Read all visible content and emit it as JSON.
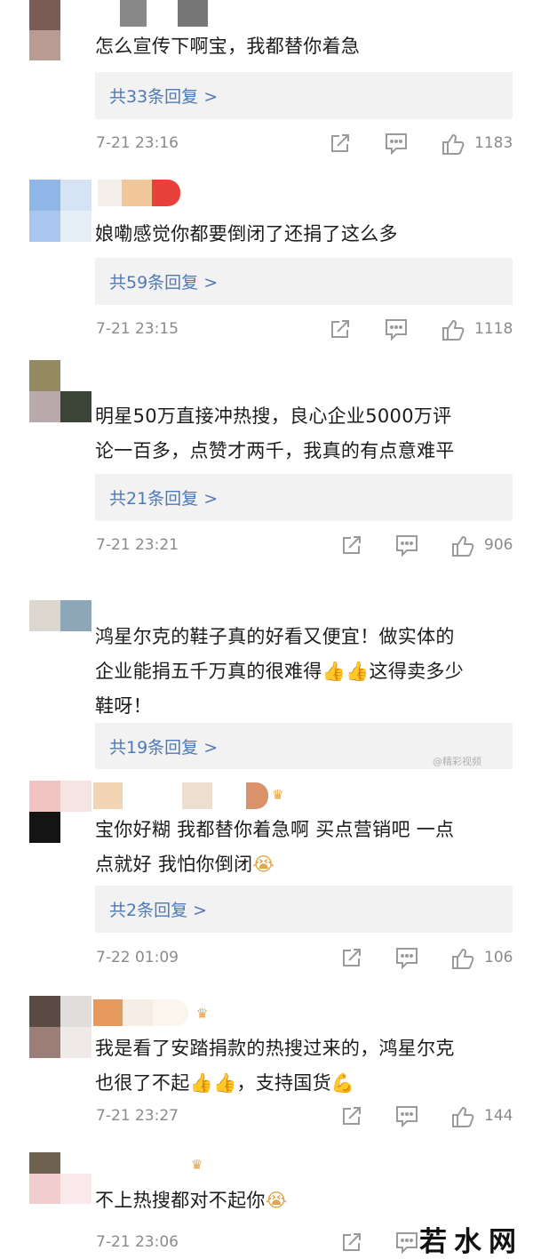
{
  "comments": [
    {
      "text": [
        "怎么宣传下啊宝，我都替你着急"
      ],
      "replies": "共33条回复",
      "chevron": ">",
      "time": "7-21 23:16",
      "likes": "1183"
    },
    {
      "text": [
        "娘嘞感觉你都要倒闭了还捐了这么多"
      ],
      "replies": "共59条回复",
      "chevron": ">",
      "time": "7-21 23:15",
      "likes": "1118"
    },
    {
      "text": [
        "明星50万直接冲热搜，良心企业5000万评",
        "论一百多，点赞才两千，我真的有点意难平"
      ],
      "replies": "共21条回复",
      "chevron": ">",
      "time": "7-21 23:21",
      "likes": "906"
    },
    {
      "text_lines": {
        "l1": "鸿星尔克的鞋子真的好看又便宜！做实体的",
        "l2a": "企业能捐五千万真的很难得",
        "l2emoji": "👍👍",
        "l2b": "这得卖多少",
        "l3": "鞋呀！"
      },
      "replies": "共19条回复",
      "chevron": ">"
    },
    {
      "text_lines": {
        "l1": "宝你好糊 我都替你着急啊 买点营销吧 一点",
        "l2": "点就好 我怕你倒闭",
        "l2emoji": "😭"
      },
      "replies": "共2条回复",
      "chevron": ">",
      "time": "7-22 01:09",
      "likes": "106"
    },
    {
      "text_lines": {
        "l1": "我是看了安踏捐款的热搜过来的，鸿星尔克",
        "l2a": "也很了不起",
        "l2emoji": "👍👍",
        "l2b": "，支持国货",
        "l2emoji2": "💪"
      },
      "time": "7-21 23:27",
      "likes": "144"
    },
    {
      "text_lines": {
        "l1": "不上热搜都对不起你",
        "l1emoji": "😭"
      },
      "time": "7-21 23:06"
    }
  ],
  "crown_glyph": "♛",
  "watermark": "@精彩视频",
  "brand": "若水网",
  "colors": {
    "link": "#4e79b8",
    "reply_bg": "#f2f2f2",
    "meta_gray": "#8a8a8a",
    "text": "#1c1c1c"
  },
  "icons": [
    "share-icon",
    "comment-icon",
    "like-icon",
    "crown-icon"
  ]
}
